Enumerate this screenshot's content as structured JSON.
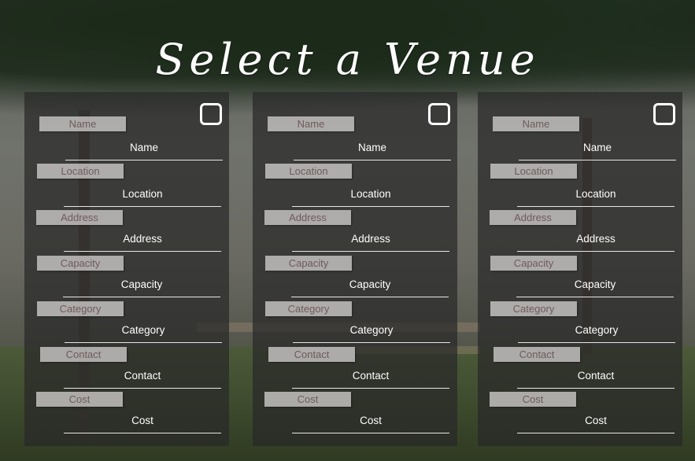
{
  "title": "Select a Venue",
  "cards": [
    {
      "fields": [
        {
          "placeholder": "Name",
          "label": "Name"
        },
        {
          "placeholder": "Location",
          "label": "Location"
        },
        {
          "placeholder": "Address",
          "label": "Address"
        },
        {
          "placeholder": "Capacity",
          "label": "Capacity"
        },
        {
          "placeholder": "Category",
          "label": "Category"
        },
        {
          "placeholder": "Contact",
          "label": "Contact"
        },
        {
          "placeholder": "Cost",
          "label": "Cost"
        }
      ]
    },
    {
      "fields": [
        {
          "placeholder": "Name",
          "label": "Name"
        },
        {
          "placeholder": "Location",
          "label": "Location"
        },
        {
          "placeholder": "Address",
          "label": "Address"
        },
        {
          "placeholder": "Capacity",
          "label": "Capacity"
        },
        {
          "placeholder": "Category",
          "label": "Category"
        },
        {
          "placeholder": "Contact",
          "label": "Contact"
        },
        {
          "placeholder": "Cost",
          "label": "Cost"
        }
      ]
    },
    {
      "fields": [
        {
          "placeholder": "Name",
          "label": "Name"
        },
        {
          "placeholder": "Location",
          "label": "Location"
        },
        {
          "placeholder": "Address",
          "label": "Address"
        },
        {
          "placeholder": "Capacity",
          "label": "Capacity"
        },
        {
          "placeholder": "Category",
          "label": "Category"
        },
        {
          "placeholder": "Contact",
          "label": "Contact"
        },
        {
          "placeholder": "Cost",
          "label": "Cost"
        }
      ]
    }
  ],
  "colors": {
    "card_background": "#282828",
    "chip_background": "#c8c6c4",
    "chip_text": "#6e5a5c",
    "text": "#ffffff"
  }
}
